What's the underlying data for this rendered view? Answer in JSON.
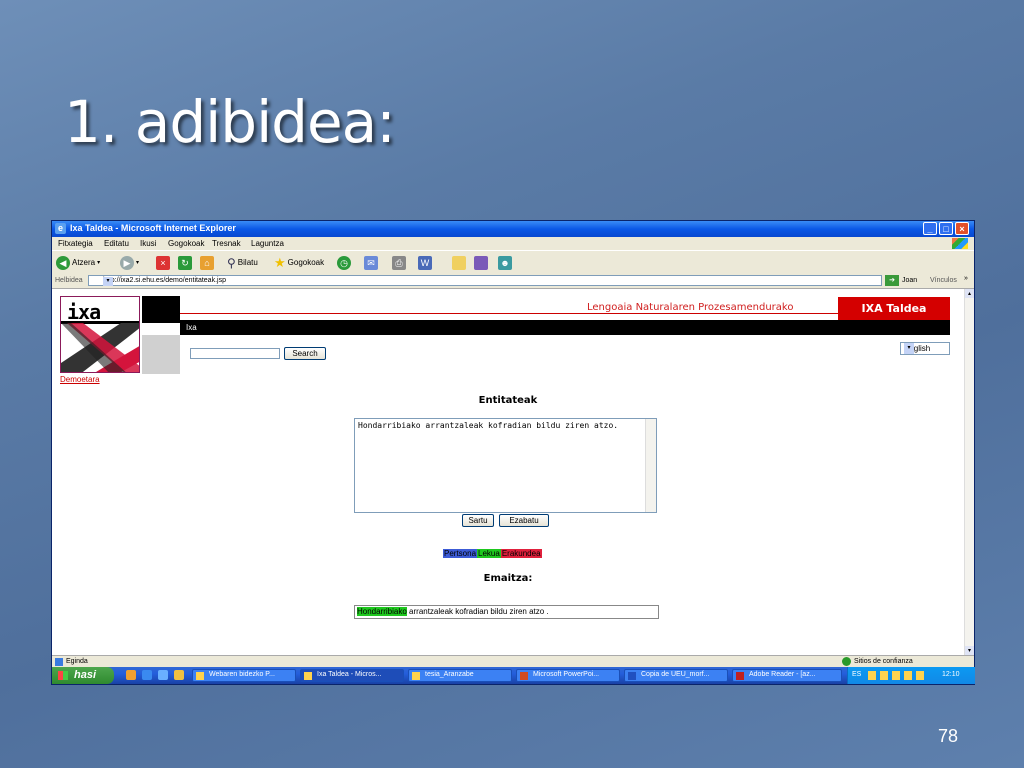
{
  "slide": {
    "title": "1. adibidea:",
    "number": "78"
  },
  "window": {
    "title": "Ixa Taldea - Microsoft Internet Explorer",
    "menu": [
      "Fitxategia",
      "Editatu",
      "Ikusi",
      "Gogokoak",
      "Tresnak",
      "Laguntza"
    ],
    "toolbar": {
      "back": "Atzera",
      "search": "Bilatu",
      "favorites": "Gogokoak"
    },
    "address_label": "Helbidea",
    "address_url": "http://ixa2.si.ehu.es/demo/entitateak.jsp",
    "go_label": "Joan",
    "links_label": "Vínculos",
    "status": {
      "left": "Eginda",
      "right": "Sitios de confianza"
    }
  },
  "page": {
    "logo_text": "ixa",
    "header_tagline": "Lengoaia Naturalaren Prozesamendurako",
    "header_brand": "IXA Taldea",
    "nav_label": "Ixa",
    "demo_link": "Demoetara",
    "search": {
      "value": "",
      "button": "Search"
    },
    "language": "English",
    "form_title": "Entitateak",
    "input_text": "Hondarribiako arrantzaleak kofradian bildu ziren atzo.",
    "buttons": {
      "submit": "Sartu",
      "clear": "Ezabatu"
    },
    "legend": [
      {
        "label": "Pertsona",
        "color": "#3c5bd6"
      },
      {
        "label": "Lekua",
        "color": "#1ec81e"
      },
      {
        "label": "Erakundea",
        "color": "#e0203c"
      }
    ],
    "result_title": "Emaitza:",
    "result": {
      "highlight": "Hondarribiako",
      "rest": " arrantzaleak kofradian bildu ziren atzo ."
    }
  },
  "taskbar": {
    "start": "hasi",
    "tasks": [
      "Webaren bidezko P...",
      "Ixa Taldea - Micros...",
      "tesia_Aranzabe",
      "Microsoft PowerPoi...",
      "Copia de UEU_morf...",
      "Adobe Reader - [az..."
    ],
    "lang": "ES",
    "clock": "12:10"
  }
}
